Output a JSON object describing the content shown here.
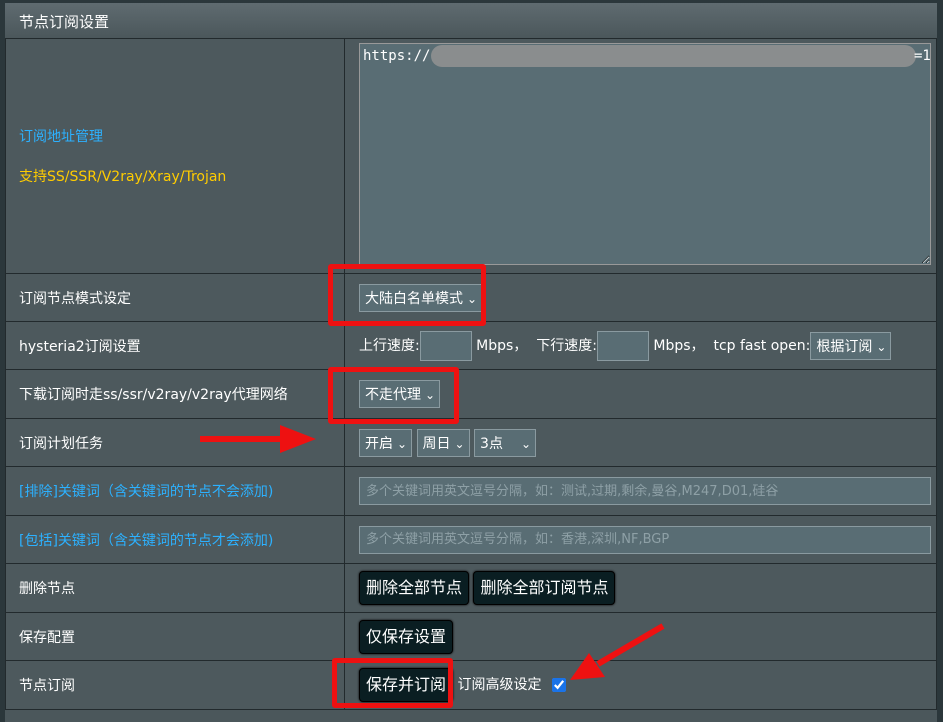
{
  "header": {
    "title": "节点订阅设置"
  },
  "rows": {
    "url_mgmt": {
      "label": "订阅地址管理",
      "support": "支持SS/SSR/V2ray/Xray/Trojan",
      "url_prefix": "https://",
      "url_suffix": "=1"
    },
    "mode": {
      "label": "订阅节点模式设定",
      "value": "大陆白名单模式"
    },
    "hysteria2": {
      "label": "hysteria2订阅设置",
      "up_label": "上行速度:",
      "up_unit": "Mbps，",
      "down_label": "下行速度:",
      "down_unit": "Mbps，",
      "tfo_label": "tcp fast open:",
      "tfo_value": "根据订阅"
    },
    "proxy": {
      "label": "下载订阅时走ss/ssr/v2ray/v2ray代理网络",
      "value": "不走代理"
    },
    "schedule": {
      "label": "订阅计划任务",
      "enable": "开启",
      "day": "周日",
      "hour": "3点"
    },
    "exclude": {
      "label": "[排除]关键词（含关键词的节点不会添加)",
      "placeholder": "多个关键词用英文逗号分隔，如：测试,过期,剩余,曼谷,M247,D01,硅谷"
    },
    "include": {
      "label": "[包括]关键词（含关键词的节点才会添加)",
      "placeholder": "多个关键词用英文逗号分隔，如：香港,深圳,NF,BGP"
    },
    "delete": {
      "label": "删除节点",
      "btn_all": "删除全部节点",
      "btn_sub": "删除全部订阅节点"
    },
    "save": {
      "label": "保存配置",
      "btn": "仅保存设置"
    },
    "subscribe": {
      "label": "节点订阅",
      "btn": "保存并订阅",
      "advanced_label": "订阅高级设定",
      "advanced_checked": true
    }
  },
  "colors": {
    "accent_blue": "#2cb1ff",
    "accent_yellow": "#ffcc00",
    "annotation_red": "#ee1111"
  }
}
